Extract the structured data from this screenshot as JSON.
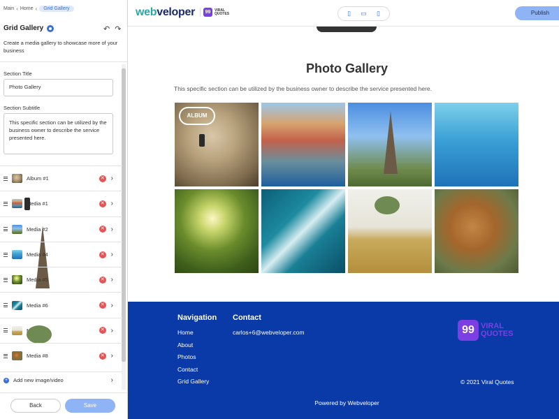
{
  "breadcrumb": {
    "items": [
      "Main",
      "Home",
      "Grid Gallery"
    ]
  },
  "panel": {
    "title": "Grid Gallery",
    "description": "Create a media gallery to showcase more of your business",
    "section_title_label": "Section Title",
    "section_title_value": "Photo Gallery",
    "section_subtitle_label": "Section Subtitle",
    "section_subtitle_value": "This specific section can be utilized by the business owner to describe the service presented here.",
    "items": [
      {
        "label": "Album #1"
      },
      {
        "label": "Media #1"
      },
      {
        "label": "Media #2"
      },
      {
        "label": "Media #4"
      },
      {
        "label": "Media #5"
      },
      {
        "label": "Media #6"
      },
      {
        "label": "Media #7"
      },
      {
        "label": "Media #8"
      }
    ],
    "add_label": "Add new image/video",
    "back_label": "Back",
    "save_label": "Save"
  },
  "topbar": {
    "brand_web": "web",
    "brand_rest": "veloper",
    "vq_badge": "99",
    "vq_line1": "VIRAL",
    "vq_line2": "QUOTES",
    "publish_label": "Publish"
  },
  "gallery": {
    "title": "Photo Gallery",
    "subtitle": "This specific section can be utilized by the business owner to describe the service presented here.",
    "album_label": "ALBUM"
  },
  "footer": {
    "nav_title": "Navigation",
    "nav_links": [
      "Home",
      "About",
      "Photos",
      "Contact",
      "Grid Gallery"
    ],
    "contact_title": "Contact",
    "email": "carlos+6@webveloper.com",
    "logo_badge": "99",
    "logo_line1": "VIRAL",
    "logo_line2": "QUOTES",
    "copyright": "© 2021 Viral Quotes",
    "powered_by": "Powered by  Webveloper"
  },
  "colors": {
    "accent": "#3a6fd8",
    "button": "#8fb4f5",
    "footer_bg": "#0a3aa7",
    "remove": "#e45454",
    "brand_web": "#2aa7a7",
    "brand_rest": "#1b2a6b"
  }
}
